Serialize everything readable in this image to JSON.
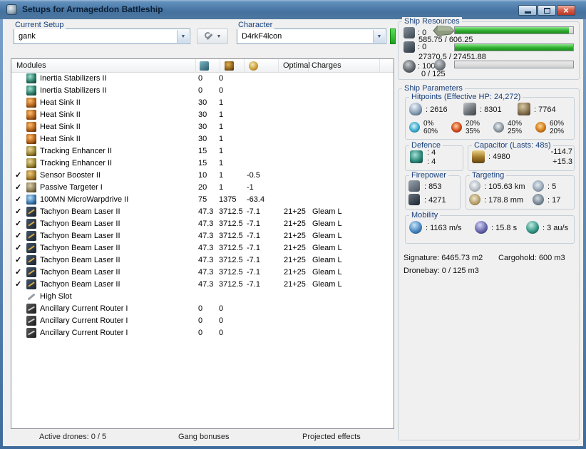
{
  "window": {
    "title": "Setups for Armageddon Battleship"
  },
  "controls": {
    "current_setup_label": "Current Setup",
    "current_setup_value": "gank",
    "character_label": "Character",
    "character_value": "D4rkF4lcon"
  },
  "modules_table": {
    "header_label": "Modules",
    "optimal_label": "Optimal",
    "charges_label": "Charges",
    "rows": [
      {
        "active": false,
        "icon": "inertia-stabilizer-icon",
        "name": "Inertia Stabilizers II",
        "cpu": "0",
        "pg": "0",
        "cap": "",
        "optimal": "",
        "charges": ""
      },
      {
        "active": false,
        "icon": "inertia-stabilizer-icon",
        "name": "Inertia Stabilizers II",
        "cpu": "0",
        "pg": "0",
        "cap": "",
        "optimal": "",
        "charges": ""
      },
      {
        "active": false,
        "icon": "heat-sink-icon",
        "name": "Heat Sink II",
        "cpu": "30",
        "pg": "1",
        "cap": "",
        "optimal": "",
        "charges": ""
      },
      {
        "active": false,
        "icon": "heat-sink-icon",
        "name": "Heat Sink II",
        "cpu": "30",
        "pg": "1",
        "cap": "",
        "optimal": "",
        "charges": ""
      },
      {
        "active": false,
        "icon": "heat-sink-icon",
        "name": "Heat Sink II",
        "cpu": "30",
        "pg": "1",
        "cap": "",
        "optimal": "",
        "charges": ""
      },
      {
        "active": false,
        "icon": "heat-sink-icon",
        "name": "Heat Sink II",
        "cpu": "30",
        "pg": "1",
        "cap": "",
        "optimal": "",
        "charges": ""
      },
      {
        "active": false,
        "icon": "tracking-enhancer-icon",
        "name": "Tracking Enhancer II",
        "cpu": "15",
        "pg": "1",
        "cap": "",
        "optimal": "",
        "charges": ""
      },
      {
        "active": false,
        "icon": "tracking-enhancer-icon",
        "name": "Tracking Enhancer II",
        "cpu": "15",
        "pg": "1",
        "cap": "",
        "optimal": "",
        "charges": ""
      },
      {
        "active": true,
        "icon": "sensor-booster-icon",
        "name": "Sensor Booster II",
        "cpu": "10",
        "pg": "1",
        "cap": "-0.5",
        "optimal": "",
        "charges": ""
      },
      {
        "active": true,
        "icon": "passive-targeter-icon",
        "name": "Passive Targeter I",
        "cpu": "20",
        "pg": "1",
        "cap": "-1",
        "optimal": "",
        "charges": ""
      },
      {
        "active": true,
        "icon": "mwd-icon",
        "name": "100MN MicroWarpdrive II",
        "cpu": "75",
        "pg": "1375",
        "cap": "-63.4",
        "optimal": "",
        "charges": ""
      },
      {
        "active": true,
        "icon": "beam-laser-icon",
        "name": "Tachyon Beam Laser II",
        "cpu": "47.3",
        "pg": "3712.5",
        "cap": "-7.1",
        "optimal": "21+25",
        "charges": "Gleam L"
      },
      {
        "active": true,
        "icon": "beam-laser-icon",
        "name": "Tachyon Beam Laser II",
        "cpu": "47.3",
        "pg": "3712.5",
        "cap": "-7.1",
        "optimal": "21+25",
        "charges": "Gleam L"
      },
      {
        "active": true,
        "icon": "beam-laser-icon",
        "name": "Tachyon Beam Laser II",
        "cpu": "47.3",
        "pg": "3712.5",
        "cap": "-7.1",
        "optimal": "21+25",
        "charges": "Gleam L"
      },
      {
        "active": true,
        "icon": "beam-laser-icon",
        "name": "Tachyon Beam Laser II",
        "cpu": "47.3",
        "pg": "3712.5",
        "cap": "-7.1",
        "optimal": "21+25",
        "charges": "Gleam L"
      },
      {
        "active": true,
        "icon": "beam-laser-icon",
        "name": "Tachyon Beam Laser II",
        "cpu": "47.3",
        "pg": "3712.5",
        "cap": "-7.1",
        "optimal": "21+25",
        "charges": "Gleam L"
      },
      {
        "active": true,
        "icon": "beam-laser-icon",
        "name": "Tachyon Beam Laser II",
        "cpu": "47.3",
        "pg": "3712.5",
        "cap": "-7.1",
        "optimal": "21+25",
        "charges": "Gleam L"
      },
      {
        "active": true,
        "icon": "beam-laser-icon",
        "name": "Tachyon Beam Laser II",
        "cpu": "47.3",
        "pg": "3712.5",
        "cap": "-7.1",
        "optimal": "21+25",
        "charges": "Gleam L"
      },
      {
        "active": false,
        "icon": "empty-slot-icon",
        "name": "High Slot",
        "cpu": "",
        "pg": "",
        "cap": "",
        "optimal": "",
        "charges": ""
      },
      {
        "active": false,
        "icon": "rig-icon",
        "name": "Ancillary Current Router I",
        "cpu": "0",
        "pg": "0",
        "cap": "",
        "optimal": "",
        "charges": ""
      },
      {
        "active": false,
        "icon": "rig-icon",
        "name": "Ancillary Current Router I",
        "cpu": "0",
        "pg": "0",
        "cap": "",
        "optimal": "",
        "charges": ""
      },
      {
        "active": false,
        "icon": "rig-icon",
        "name": "Ancillary Current Router I",
        "cpu": "0",
        "pg": "0",
        "cap": "",
        "optimal": "",
        "charges": ""
      }
    ],
    "footer": {
      "active_drones": "Active drones: 0 / 5",
      "gang_bonuses": "Gang bonuses",
      "projected_effects": "Projected effects"
    }
  },
  "ship_resources": {
    "title": "Ship Resources",
    "turret_slots": ": 0",
    "launcher_slots": ": 0",
    "calibration": ": 100",
    "cpu": {
      "text": "585.75 / 606.25",
      "pct": 96.6
    },
    "powergrid": {
      "text": "27370.5 / 27451.88",
      "pct": 99.7
    },
    "dronebay_bar": {
      "text": "0 / 125",
      "pct": 0
    }
  },
  "ship_parameters": {
    "title": "Ship Parameters",
    "hitpoints": {
      "title": "Hitpoints (Effective HP: 24,272)",
      "shield": ": 2616",
      "armor": ": 8301",
      "structure": ": 7764",
      "resists": [
        {
          "icon": "em-resist-icon",
          "shield": "0%",
          "armor": "60%"
        },
        {
          "icon": "thermal-resist-icon",
          "shield": "20%",
          "armor": "35%"
        },
        {
          "icon": "kinetic-resist-icon",
          "shield": "40%",
          "armor": "25%"
        },
        {
          "icon": "explosive-resist-icon",
          "shield": "60%",
          "armor": "20%"
        }
      ]
    },
    "defence": {
      "title": "Defence",
      "value_top": ": 4",
      "value_bottom": ": 4"
    },
    "capacitor": {
      "title": "Capacitor (Lasts: 48s)",
      "capacity": ": 4980",
      "drain": "-114.7",
      "recharge": "+15.3"
    },
    "firepower": {
      "title": "Firepower",
      "dps": ": 853",
      "volley": ": 4271"
    },
    "targeting": {
      "title": "Targeting",
      "range": ": 105.63 km",
      "max_targets": ": 5",
      "scan_resolution": ": 178.8 mm",
      "sensor_strength": ": 17"
    },
    "mobility": {
      "title": "Mobility",
      "speed": ": 1163 m/s",
      "align_time": ": 15.8 s",
      "warp_speed": ": 3 au/s"
    },
    "signature": "Signature: 6465.73 m2",
    "cargohold": "Cargohold: 600 m3",
    "dronebay": "Dronebay: 0 / 125 m3"
  },
  "colors": {
    "accent_green": "#2fae2f",
    "titlebar_blue": "#44719f",
    "group_label": "#17407c"
  }
}
